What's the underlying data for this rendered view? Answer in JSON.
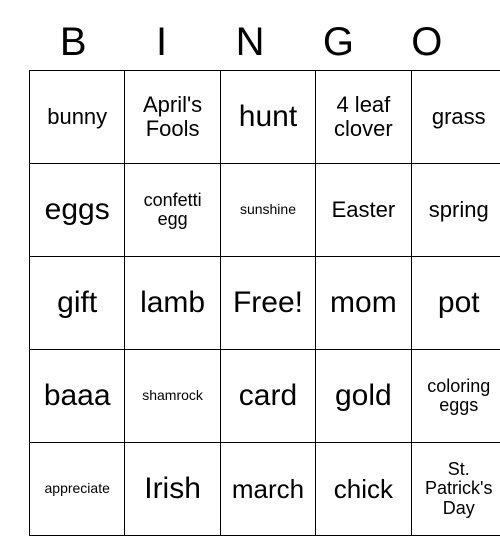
{
  "card": {
    "title": "BINGO",
    "headers": [
      "B",
      "I",
      "N",
      "G",
      "O"
    ],
    "rows": [
      [
        {
          "text": "bunny",
          "size": "md"
        },
        {
          "text": "April's Fools",
          "size": "md"
        },
        {
          "text": "hunt",
          "size": "xl"
        },
        {
          "text": "4 leaf clover",
          "size": "md"
        },
        {
          "text": "grass",
          "size": "md"
        }
      ],
      [
        {
          "text": "eggs",
          "size": "xl"
        },
        {
          "text": "confetti egg",
          "size": "sm"
        },
        {
          "text": "sunshine",
          "size": "xs"
        },
        {
          "text": "Easter",
          "size": "md"
        },
        {
          "text": "spring",
          "size": "md"
        }
      ],
      [
        {
          "text": "gift",
          "size": "xl"
        },
        {
          "text": "lamb",
          "size": "xl"
        },
        {
          "text": "Free!",
          "size": "xl"
        },
        {
          "text": "mom",
          "size": "xl"
        },
        {
          "text": "pot",
          "size": "xl"
        }
      ],
      [
        {
          "text": "baaa",
          "size": "xl"
        },
        {
          "text": "shamrock",
          "size": "xs"
        },
        {
          "text": "card",
          "size": "xl"
        },
        {
          "text": "gold",
          "size": "xl"
        },
        {
          "text": "coloring eggs",
          "size": "sm"
        }
      ],
      [
        {
          "text": "appreciate",
          "size": "xs"
        },
        {
          "text": "Irish",
          "size": "xl"
        },
        {
          "text": "march",
          "size": "lg"
        },
        {
          "text": "chick",
          "size": "lg"
        },
        {
          "text": "St. Patrick's Day",
          "size": "sm"
        }
      ]
    ],
    "free_space": {
      "row": 2,
      "col": 2,
      "label": "Free!"
    },
    "colors": {
      "background": "#ffffff",
      "text": "#000000",
      "grid_line": "#000000"
    }
  }
}
